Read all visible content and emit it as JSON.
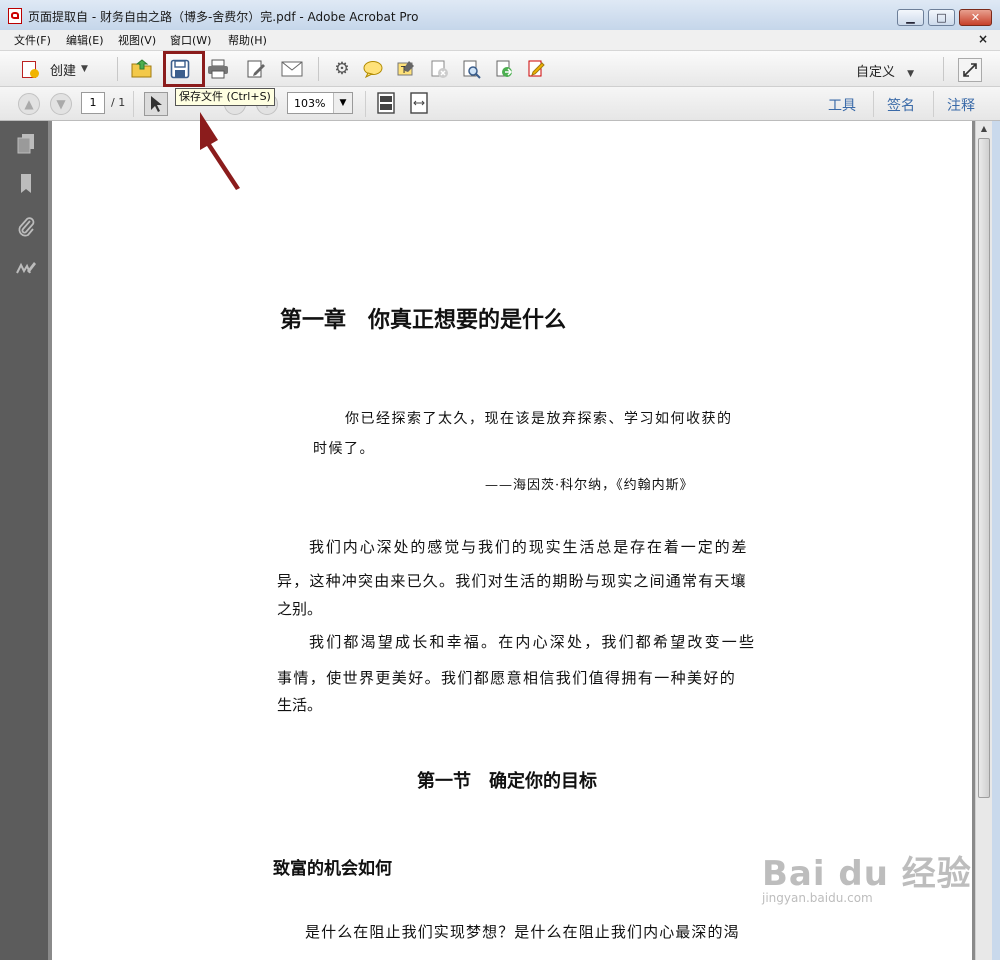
{
  "window": {
    "title": "页面提取自 - 财务自由之路（博多-舍费尔）完.pdf - Adobe Acrobat Pro",
    "buttons": {
      "minimize": "▁",
      "maximize": "□",
      "close": "✕"
    }
  },
  "menu": {
    "items": [
      "文件(F)",
      "编辑(E)",
      "视图(V)",
      "窗口(W)",
      "帮助(H)"
    ],
    "close_doc": "×"
  },
  "toolbar": {
    "create_label": "创建",
    "customize_label": "自定义"
  },
  "nav": {
    "page_value": "1",
    "page_total": "/ 1",
    "zoom_value": "103%"
  },
  "panels": {
    "tools": "工具",
    "sign": "签名",
    "comment": "注释"
  },
  "tooltip": {
    "save": "保存文件 (Ctrl+S)"
  },
  "document": {
    "chapter_title": "第一章　你真正想要的是什么",
    "quote_line1": "你已经探索了太久，现在该是放弃探索、学习如何收获的",
    "quote_line2": "时候了。",
    "quote_attribution": "——海因茨·科尔纳，《约翰内斯》",
    "para1_line1": "我们内心深处的感觉与我们的现实生活总是存在着一定的差",
    "para1_line2": "异，这种冲突由来已久。我们对生活的期盼与现实之间通常有天壤",
    "para1_line3": "之别。",
    "para2_line1": "我们都渴望成长和幸福。在内心深处，我们都希望改变一些",
    "para2_line2": "事情，使世界更美好。我们都愿意相信我们值得拥有一种美好的",
    "para2_line3": "生活。",
    "section_title": "第一节　确定你的目标",
    "subsection_title": "致富的机会如何",
    "para3_line1": "是什么在阻止我们实现梦想？是什么在阻止我们内心最深的渴"
  },
  "watermark": {
    "logo": "Bai du 经验",
    "url": "jingyan.baidu.com"
  }
}
